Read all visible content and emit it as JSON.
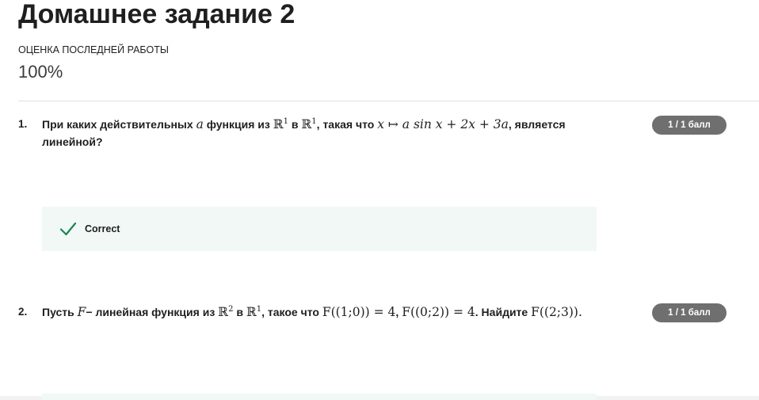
{
  "header": {
    "title": "Домашнее задание 2",
    "grade_label": "ОЦЕНКА ПОСЛЕДНЕЙ РАБОТЫ",
    "grade_value": "100%"
  },
  "questions": [
    {
      "number": "1.",
      "score": "1 / 1 балл",
      "text": {
        "p1": "При каких действительных",
        "var_a": "a",
        "p2": "функция из",
        "R": "ℝ",
        "exp1": "1",
        "p3": "в",
        "exp2": "1",
        "p4": ", такая что",
        "formula": "x ↦ a sin x + 2x + 3a",
        "p5": ", является линейной?"
      },
      "feedback": {
        "icon": "check-icon",
        "label": "Correct",
        "color": "#1f8354"
      }
    },
    {
      "number": "2.",
      "score": "1 / 1 балл",
      "text": {
        "p1": "Пусть",
        "var_F": "F",
        "p2": "− линейная функция из",
        "R": "ℝ",
        "exp1": "2",
        "p3": "в",
        "exp2": "1",
        "p4": ", такое что",
        "formula1": "F((1;0)) = 4",
        "sep": ",",
        "formula2": "F((0;2)) = 4",
        "p5": ". Найдите",
        "formula3": "F((2;3))",
        "p6": "."
      }
    }
  ],
  "colors": {
    "badge_bg": "#6f6f6f",
    "feedback_bg": "#f1f8f5",
    "correct_green": "#1f8354"
  }
}
